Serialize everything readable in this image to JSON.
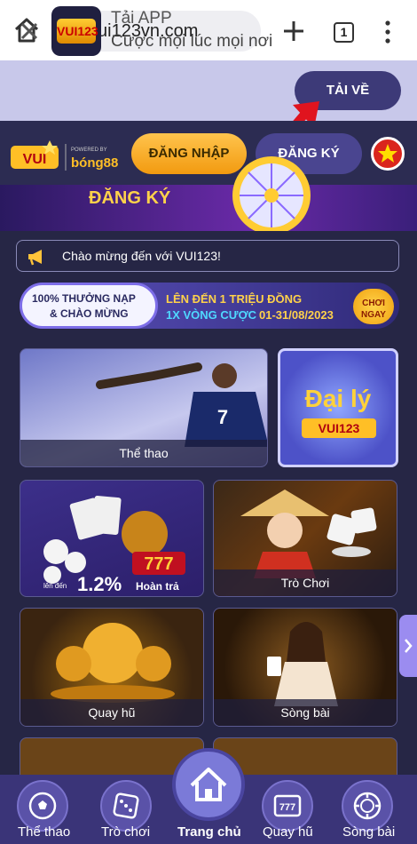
{
  "browser": {
    "url": "vui123vn.com",
    "tab_count": "1"
  },
  "app_banner": {
    "title": "Tải APP",
    "subtitle": "Cược mọi lúc mọi nơi",
    "download_label": "TẢI VỀ"
  },
  "header": {
    "login_label": "ĐĂNG NHẬP",
    "register_label": "ĐĂNG KÝ",
    "logo_text": "VUI123",
    "powered_by": "bóng88"
  },
  "hero": {
    "text": "ĐĂNG KÝ"
  },
  "notice": {
    "text": "Chào mừng đến với VUI123!"
  },
  "promo": {
    "left_line1": "100% THƯỞNG NẠP",
    "left_line2": "& CHÀO MỪNG",
    "right_line1": "LÊN ĐẾN 1 TRIỆU ĐỒNG",
    "right_line2a": "1X VÒNG CƯỢC",
    "right_line2b": "01-31/08/2023",
    "cta_line1": "CHƠI",
    "cta_line2": "NGAY"
  },
  "tiles": {
    "sports": "Thể thao",
    "agency": "Đại lý",
    "agency_brand": "VUI123",
    "lottery_percent": "1.2%",
    "lottery_caption": "Hoàn trả",
    "lottery_prefix": "lên đến",
    "games": "Trò Chơi",
    "slots": "Quay hũ",
    "casino": "Sòng bài"
  },
  "bottom_nav": {
    "sports": "Thể thao",
    "games": "Trò chơi",
    "home": "Trang chủ",
    "slots": "Quay hũ",
    "casino": "Sòng bài"
  },
  "colors": {
    "accent_gold": "#f29a10",
    "nav_purple": "#3a3478",
    "banner_lavender": "#c8c8ea"
  }
}
